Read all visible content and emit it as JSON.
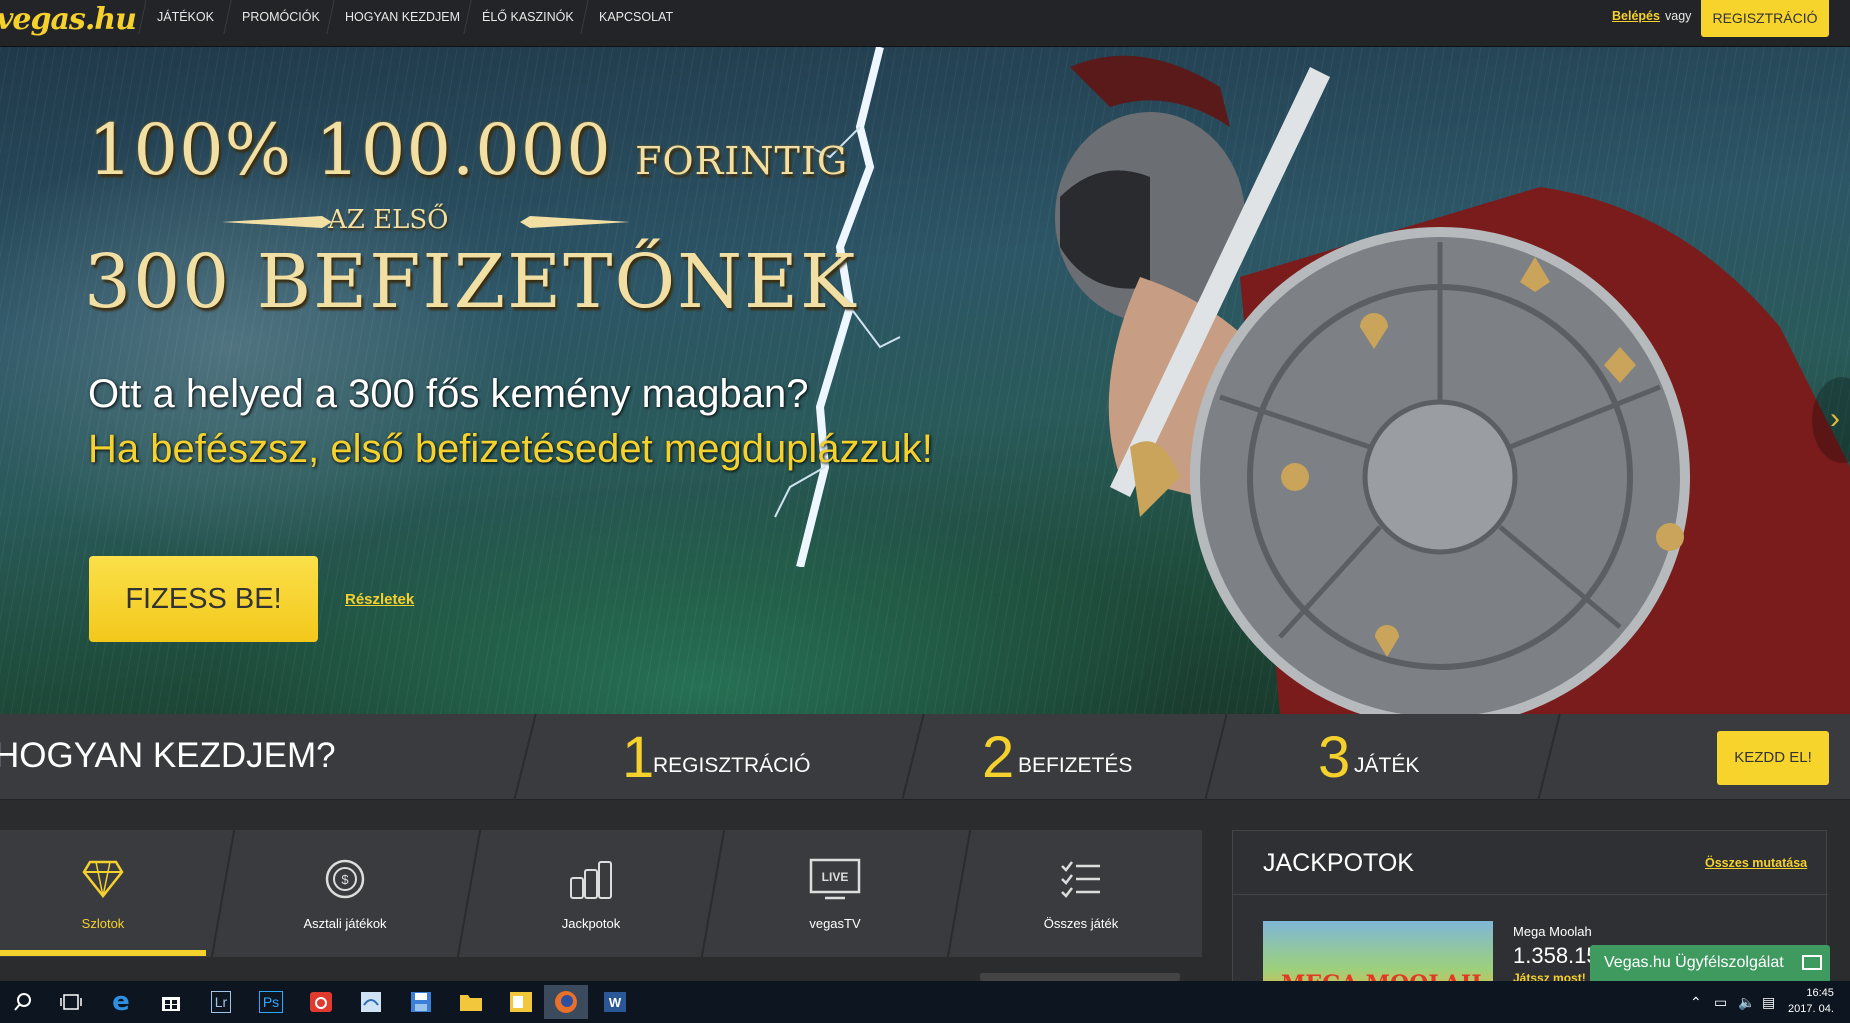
{
  "nav": {
    "logo": "vegas.hu",
    "items": [
      "JÁTÉKOK",
      "PROMÓCIÓK",
      "HOGYAN KEZDJEM",
      "ÉLŐ KASZINÓK",
      "KAPCSOLAT"
    ],
    "login": "Belépés",
    "or": "vagy",
    "register": "REGISZTRÁCIÓ"
  },
  "hero": {
    "line1_big": "100% 100.000",
    "line1_small": "FORINTIG",
    "line2": "AZ ELSŐ",
    "line3": "300 BEFIZETŐNEK",
    "subtitle_white": "Ott a helyed a 300 fős kemény magban?",
    "subtitle_yellow": "Ha befészsz, első befizetésedet megduplázzuk!",
    "cta": "FIZESS BE!",
    "details_link": "Részletek"
  },
  "steps": {
    "title": "HOGYAN KEZDJEM?",
    "items": [
      {
        "num": "1",
        "label": "REGISZTRÁCIÓ"
      },
      {
        "num": "2",
        "label": "BEFIZETÉS"
      },
      {
        "num": "3",
        "label": "JÁTÉK"
      }
    ],
    "start": "KEZDD EL!"
  },
  "categories": [
    {
      "label": "Szlotok",
      "icon": "diamond-icon"
    },
    {
      "label": "Asztali játékok",
      "icon": "roulette-icon"
    },
    {
      "label": "Jackpotok",
      "icon": "coin-stack-icon"
    },
    {
      "label": "vegasTV",
      "icon": "live-tv-icon",
      "icon_text": "LIVE"
    },
    {
      "label": "Összes játék",
      "icon": "checklist-icon"
    }
  ],
  "jackpots": {
    "title": "JACKPOTOK",
    "show_all": "Összes mutatása",
    "item": {
      "name": "Mega Moolah",
      "amount": "1.358.15",
      "play": "Játssz most!",
      "image_text": "MEGA MOOLAH"
    }
  },
  "support": "Vegas.hu Ügyfélszolgálat",
  "taskbar": {
    "apps": [
      "search-icon",
      "task-view-icon",
      "edge-icon",
      "store-icon",
      "lightroom-icon",
      "photoshop-icon",
      "camera-icon",
      "app-icon",
      "save-icon",
      "file-explorer-icon",
      "outlook-icon",
      "firefox-icon",
      "word-icon"
    ],
    "time": "16:45",
    "date": "2017. 04."
  },
  "colors": {
    "accent": "#f5d12e",
    "bg": "#2b2c2e",
    "support": "#3f9a5f"
  }
}
